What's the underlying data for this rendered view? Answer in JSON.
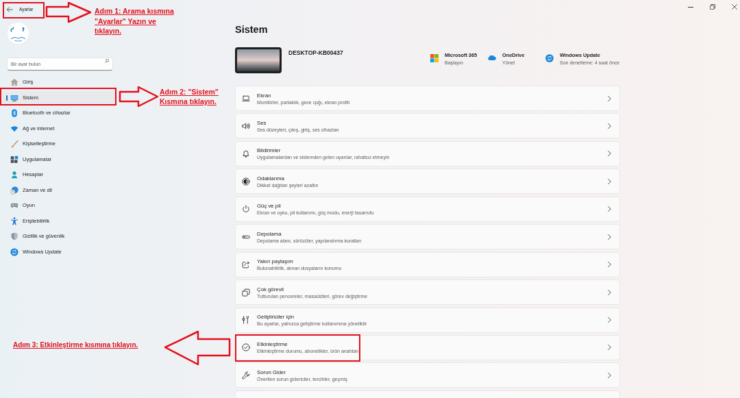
{
  "window": {
    "title": "Ayarlar"
  },
  "search": {
    "placeholder": "Bir ayar bulun"
  },
  "sidebar": {
    "items": [
      {
        "label": "Giriş",
        "selected": false
      },
      {
        "label": "Sistem",
        "selected": true
      },
      {
        "label": "Bluetooth ve cihazlar",
        "selected": false
      },
      {
        "label": "Ağ ve internet",
        "selected": false
      },
      {
        "label": "Kişiselleştirme",
        "selected": false
      },
      {
        "label": "Uygulamalar",
        "selected": false
      },
      {
        "label": "Hesaplar",
        "selected": false
      },
      {
        "label": "Zaman ve dil",
        "selected": false
      },
      {
        "label": "Oyun",
        "selected": false
      },
      {
        "label": "Erişilebilirlik",
        "selected": false
      },
      {
        "label": "Gizlilik ve güvenlik",
        "selected": false
      },
      {
        "label": "Windows Update",
        "selected": false
      }
    ]
  },
  "page": {
    "title": "Sistem"
  },
  "device": {
    "name": "DESKTOP-KB00437"
  },
  "quick_links": [
    {
      "title": "Microsoft 365",
      "subtitle": "Başlayın"
    },
    {
      "title": "OneDrive",
      "subtitle": "Yönet"
    },
    {
      "title": "Windows Update",
      "subtitle": "Son denetleme: 4 saat önce"
    }
  ],
  "settings": [
    {
      "title": "Ekran",
      "subtitle": "Monitörler, parlaklık, gece ışığı, ekran profili"
    },
    {
      "title": "Ses",
      "subtitle": "Ses düzeyleri, çıkış, giriş, ses cihazları"
    },
    {
      "title": "Bildirimler",
      "subtitle": "Uygulamalardan ve sistemden gelen uyarılar, rahatsız etmeyin"
    },
    {
      "title": "Odaklanma",
      "subtitle": "Dikkat dağıtan şeyleri azaltın"
    },
    {
      "title": "Güç ve pil",
      "subtitle": "Ekran ve uyku, pil kullanımı, güç modu, enerji tasarrufu"
    },
    {
      "title": "Depolama",
      "subtitle": "Depolama alanı, sürücüler, yapılandırma kuralları"
    },
    {
      "title": "Yakın paylaşım",
      "subtitle": "Bulunabilirlik, alınan dosyaların konumu"
    },
    {
      "title": "Çok görevli",
      "subtitle": "Tutturulan pencereler, masaüstleri, görev değiştirme"
    },
    {
      "title": "Geliştiriciler için",
      "subtitle": "Bu ayarlar, yalnızca geliştirme kullanımına yöneliktir"
    },
    {
      "title": "Etkinleştirme",
      "subtitle": "Etkinleştirme durumu, abonelikler, ürün anahtarı"
    },
    {
      "title": "Sorun Gider",
      "subtitle": "Önerilen sorun gidericiler, tercihler, geçmiş"
    }
  ],
  "annotations": [
    {
      "lines": [
        "Adım 1: Arama kısmına",
        "\"Ayarlar\" Yazın ve",
        "tıklayın."
      ]
    },
    {
      "lines": [
        "Adım 2: \"Sistem\"",
        "Kısmına tıklayın."
      ]
    },
    {
      "lines": [
        "Adım 3: Etkinleştirme kısmına tıklayın."
      ]
    }
  ]
}
